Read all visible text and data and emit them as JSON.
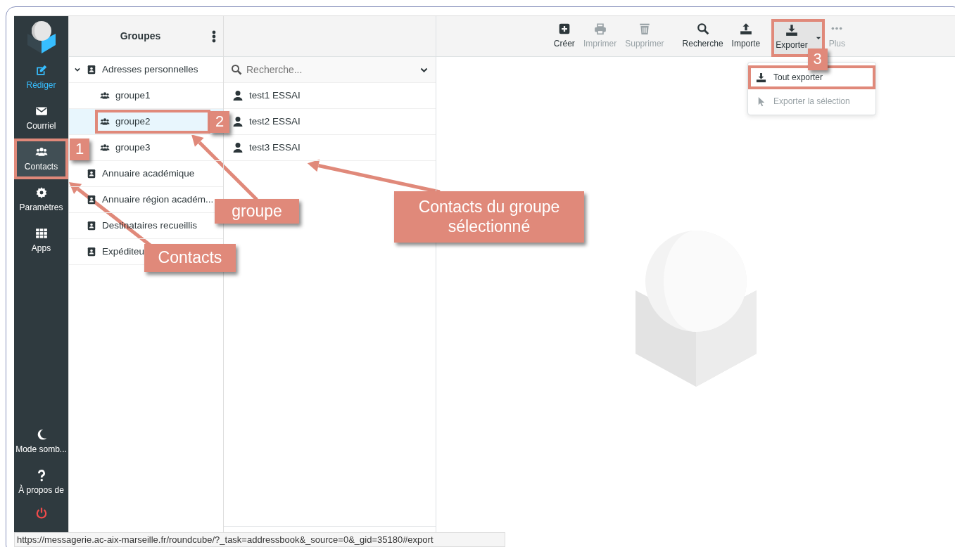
{
  "sidebar": {
    "items": [
      {
        "label": "Rédiger",
        "kind": "compose",
        "selected": false
      },
      {
        "label": "Courriel",
        "kind": "mail",
        "selected": false
      },
      {
        "label": "Contacts",
        "kind": "contacts",
        "selected": true
      },
      {
        "label": "Paramètres",
        "kind": "settings",
        "selected": false
      },
      {
        "label": "Apps",
        "kind": "apps",
        "selected": false
      }
    ],
    "bottom_items": [
      {
        "label": "Mode somb...",
        "kind": "dark-mode"
      },
      {
        "label": "À propos de",
        "kind": "about"
      },
      {
        "kind": "logout"
      }
    ]
  },
  "groups": {
    "title": "Groupes",
    "items": [
      {
        "label": "Adresses personnelles",
        "kind": "addressbook",
        "expanded": true,
        "selected": false,
        "children": [
          {
            "label": "groupe1",
            "kind": "group",
            "selected": false
          },
          {
            "label": "groupe2",
            "kind": "group",
            "selected": true
          },
          {
            "label": "groupe3",
            "kind": "group",
            "selected": false
          }
        ]
      },
      {
        "label": "Annuaire académique",
        "kind": "addressbook",
        "selected": false
      },
      {
        "label": "Annuaire région académ...",
        "kind": "addressbook",
        "selected": false
      },
      {
        "label": "Destinataires recueillis",
        "kind": "addressbook",
        "selected": false
      },
      {
        "label": "Expéditeu",
        "kind": "addressbook",
        "selected": false
      }
    ]
  },
  "contacts": {
    "search": {
      "placeholder": "Recherche..."
    },
    "items": [
      {
        "name": "test1 ESSAI"
      },
      {
        "name": "test2 ESSAI"
      },
      {
        "name": "test3 ESSAI"
      }
    ]
  },
  "toolbar": {
    "items": [
      {
        "label": "Créer",
        "kind": "create",
        "disabled": false,
        "expanded": false
      },
      {
        "label": "Imprimer",
        "kind": "print",
        "disabled": true,
        "expanded": false
      },
      {
        "label": "Supprimer",
        "kind": "delete",
        "disabled": true,
        "expanded": false
      },
      {
        "label": "Recherche",
        "kind": "search",
        "disabled": false,
        "expanded": false
      },
      {
        "label": "Importe",
        "kind": "import",
        "disabled": false,
        "expanded": false
      },
      {
        "label": "Exporter",
        "kind": "export",
        "disabled": false,
        "expanded": true
      },
      {
        "label": "Plus",
        "kind": "more",
        "disabled": true,
        "expanded": false
      }
    ]
  },
  "export_menu": {
    "items": [
      {
        "label": "Tout exporter",
        "kind": "export-all",
        "disabled": false
      },
      {
        "label": "Exporter la sélection",
        "kind": "export-selected",
        "disabled": true
      }
    ]
  },
  "status_bar": {
    "url": "https://messagerie.ac-aix-marseille.fr/roundcube/?_task=addressbook&_source=0&_gid=35180#export"
  },
  "annotations": [
    {
      "kind": "number",
      "text": "1"
    },
    {
      "kind": "number",
      "text": "2"
    },
    {
      "kind": "number",
      "text": "3"
    },
    {
      "kind": "label",
      "text": "groupe"
    },
    {
      "kind": "label",
      "text": "Contacts"
    },
    {
      "kind": "label",
      "text": "Contacts du groupe sélectionné"
    }
  ]
}
